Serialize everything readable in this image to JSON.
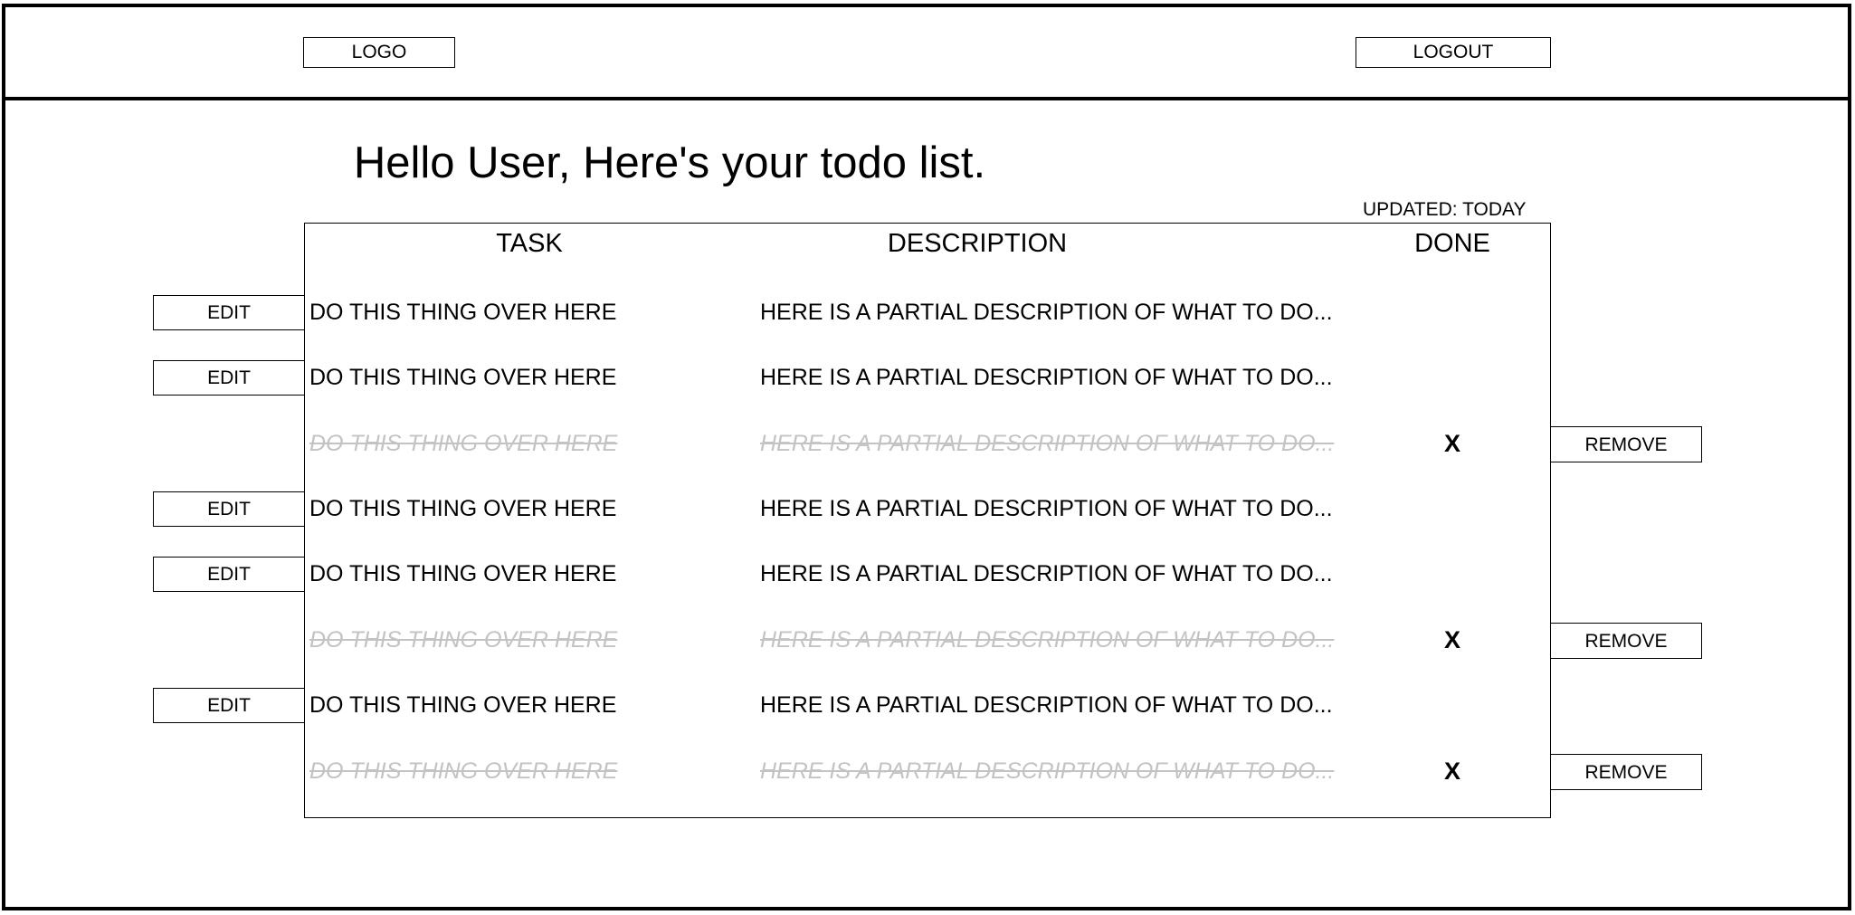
{
  "header": {
    "logo_label": "LOGO",
    "logout_label": "LOGOUT"
  },
  "main": {
    "greeting": "Hello User, Here's your todo list.",
    "updated": "UPDATED: TODAY"
  },
  "table": {
    "columns": [
      "TASK",
      "DESCRIPTION",
      "DONE"
    ],
    "edit_label": "EDIT",
    "remove_label": "REMOVE",
    "rows": [
      {
        "task": "DO THIS THING OVER HERE",
        "description": "HERE IS A PARTIAL DESCRIPTION OF WHAT TO DO...",
        "done": false,
        "done_mark": ""
      },
      {
        "task": "DO THIS THING OVER HERE",
        "description": "HERE IS A PARTIAL DESCRIPTION OF WHAT TO DO...",
        "done": false,
        "done_mark": ""
      },
      {
        "task": "DO THIS THING OVER HERE",
        "description": "HERE IS A PARTIAL DESCRIPTION OF WHAT TO DO...",
        "done": true,
        "done_mark": "X"
      },
      {
        "task": "DO THIS THING OVER HERE",
        "description": "HERE IS A PARTIAL DESCRIPTION OF WHAT TO DO...",
        "done": false,
        "done_mark": ""
      },
      {
        "task": "DO THIS THING OVER HERE",
        "description": "HERE IS A PARTIAL DESCRIPTION OF WHAT TO DO...",
        "done": false,
        "done_mark": ""
      },
      {
        "task": "DO THIS THING OVER HERE",
        "description": "HERE IS A PARTIAL DESCRIPTION OF WHAT TO DO...",
        "done": true,
        "done_mark": "X"
      },
      {
        "task": "DO THIS THING OVER HERE",
        "description": "HERE IS A PARTIAL DESCRIPTION OF WHAT TO DO...",
        "done": false,
        "done_mark": ""
      },
      {
        "task": "DO THIS THING OVER HERE",
        "description": "HERE IS A PARTIAL DESCRIPTION OF WHAT TO DO...",
        "done": true,
        "done_mark": "X"
      }
    ]
  }
}
